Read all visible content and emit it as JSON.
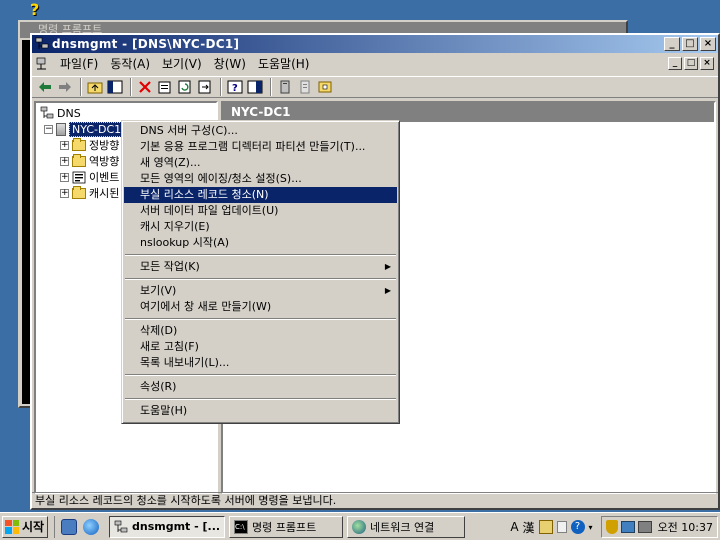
{
  "background_window": {
    "title": "명령 프롬프트"
  },
  "window": {
    "title": "dnsmgmt - [DNS\\NYC-DC1]",
    "controls": {
      "minimize": "_",
      "maximize": "□",
      "close": "×"
    }
  },
  "menubar": {
    "items": [
      "파일(F)",
      "동작(A)",
      "보기(V)",
      "창(W)",
      "도움말(H)"
    ]
  },
  "tree": {
    "root": "DNS",
    "server": "NYC-DC1",
    "children": [
      "정방향",
      "역방향",
      "이벤트",
      "캐시된"
    ]
  },
  "right_pane": {
    "header": "NYC-DC1"
  },
  "context_menu": {
    "groups": [
      [
        {
          "label": "DNS 서버 구성(C)..."
        },
        {
          "label": "기본 응용 프로그램 디렉터리 파티션 만들기(T)..."
        },
        {
          "label": "새 영역(Z)..."
        },
        {
          "label": "모든 영역의 에이징/청소 설정(S)..."
        },
        {
          "label": "부실 리소스 레코드 청소(N)",
          "highlighted": true
        },
        {
          "label": "서버 데이터 파일 업데이트(U)"
        },
        {
          "label": "캐시 지우기(E)"
        },
        {
          "label": "nslookup 시작(A)"
        }
      ],
      [
        {
          "label": "모든 작업(K)",
          "submenu": true
        }
      ],
      [
        {
          "label": "보기(V)",
          "submenu": true
        },
        {
          "label": "여기에서 창 새로 만들기(W)"
        }
      ],
      [
        {
          "label": "삭제(D)"
        },
        {
          "label": "새로 고침(F)"
        },
        {
          "label": "목록 내보내기(L)..."
        }
      ],
      [
        {
          "label": "속성(R)"
        }
      ],
      [
        {
          "label": "도움말(H)"
        }
      ]
    ]
  },
  "statusbar": {
    "text": "부실 리소스 레코드의 청소를 시작하도록 서버에 명령을 보냅니다."
  },
  "taskbar": {
    "start_label": "시작",
    "tasks": [
      {
        "label": "dnsmgmt - [...",
        "active": true
      },
      {
        "label": "명령 프롬프트",
        "active": false
      },
      {
        "label": "네트워크 연결",
        "active": false
      }
    ],
    "ime": {
      "mode": "A",
      "hanja": "漢"
    },
    "clock": "오전 10:37"
  },
  "colors": {
    "desktop": "#3a6ea5",
    "title_active": "#0a246a",
    "menu_highlight": "#0a246a",
    "face": "#d4d0c8"
  }
}
